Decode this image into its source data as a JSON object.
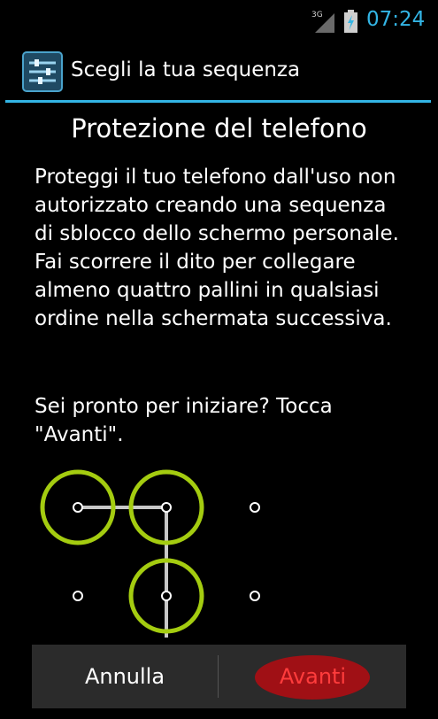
{
  "status_bar": {
    "network": "3G",
    "time": "07:24"
  },
  "action_bar": {
    "title": "Scegli la tua sequenza",
    "icon": "settings-sliders-icon"
  },
  "main": {
    "title": "Protezione del telefono",
    "description": "Proteggi il tuo telefono dall'uso non autorizzato creando una sequenza di sblocco dello schermo personale. Fai scorrere il dito per collegare almeno quattro pallini in qualsiasi ordine nella schermata successiva.",
    "prompt": "Sei pronto per iniziare? Tocca \"Avanti\"."
  },
  "buttons": {
    "cancel": "Annulla",
    "next": "Avanti"
  },
  "colors": {
    "accent": "#33b5e5",
    "pattern": "#a4cc10",
    "highlight": "#a01015"
  }
}
